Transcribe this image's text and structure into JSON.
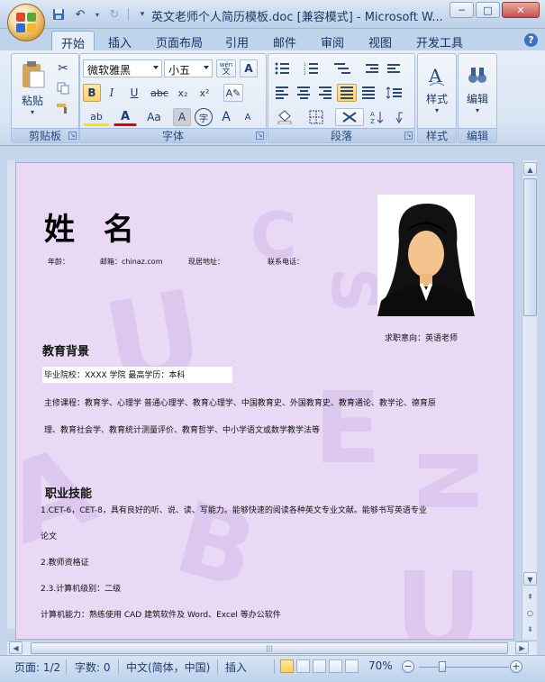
{
  "window": {
    "title": "英文老师个人简历模板.doc [兼容模式] - Microsoft W...",
    "controls": {
      "minimize": "─",
      "maximize": "□",
      "close": "✕"
    }
  },
  "qat": {
    "save_icon": "save-icon",
    "undo_icon": "undo-icon",
    "redo_icon": "redo-icon",
    "customize": "▾"
  },
  "tabs": [
    "开始",
    "插入",
    "页面布局",
    "引用",
    "邮件",
    "审阅",
    "视图",
    "开发工具"
  ],
  "active_tab": "开始",
  "ribbon": {
    "clipboard": {
      "label": "剪贴板",
      "paste": "粘贴"
    },
    "font": {
      "label": "字体",
      "font_name": "微软雅黑",
      "font_size": "小五",
      "wen": "wén\n文",
      "A": "A",
      "bold": "B",
      "italic": "I",
      "underline": "U",
      "strike": "abc",
      "sub": "x₂",
      "sup": "x²",
      "clear": "A̸",
      "highlight": "ab",
      "color": "A",
      "case": "Aa",
      "shade": "A",
      "enclose": "字",
      "grow": "A",
      "shrink": "A"
    },
    "paragraph": {
      "label": "段落"
    },
    "styles": {
      "label": "样式"
    },
    "editing": {
      "label": "编辑"
    }
  },
  "document": {
    "name": "姓 名",
    "info": {
      "age": "年龄：",
      "email": "邮箱：chinaz.com",
      "address": "现居地址：",
      "phone": "联系电话："
    },
    "intent": "求职意向：英语老师",
    "education": {
      "title": "教育背景",
      "school_line": "毕业院校：XXXX 学院          最高学历：本科",
      "courses_1": "主修课程：教育学、心理学  普通心理学、教育心理学、中国教育史、外国教育史、教育通论、教学论、德育原",
      "courses_2": "理、教育社会学、教育统计测量评价、教育哲学、中小学语文或数学教学法等"
    },
    "skills": {
      "title": "职业技能",
      "line1": "1.CET-6，CET-8，具有良好的听、说、读、写能力。能够快速的阅读各种英文专业文献。能够书写英语专业",
      "line2": "论文",
      "line3": "2.教师资格证",
      "line4": "2.3.计算机级别：二级",
      "line5": "计算机能力：熟练使用 CAD 建筑软件及 Word、Excel 等办公软件"
    }
  },
  "status": {
    "page": "页面: 1/2",
    "words": "字数: 0",
    "language": "中文(简体，中国)",
    "mode": "插入",
    "zoom": "70%",
    "zoom_out": "−",
    "zoom_in": "+"
  },
  "colors": {
    "page_bg": "#e9d9f5",
    "chrome": "#c5d6ec",
    "accent": "#ffd36a"
  }
}
